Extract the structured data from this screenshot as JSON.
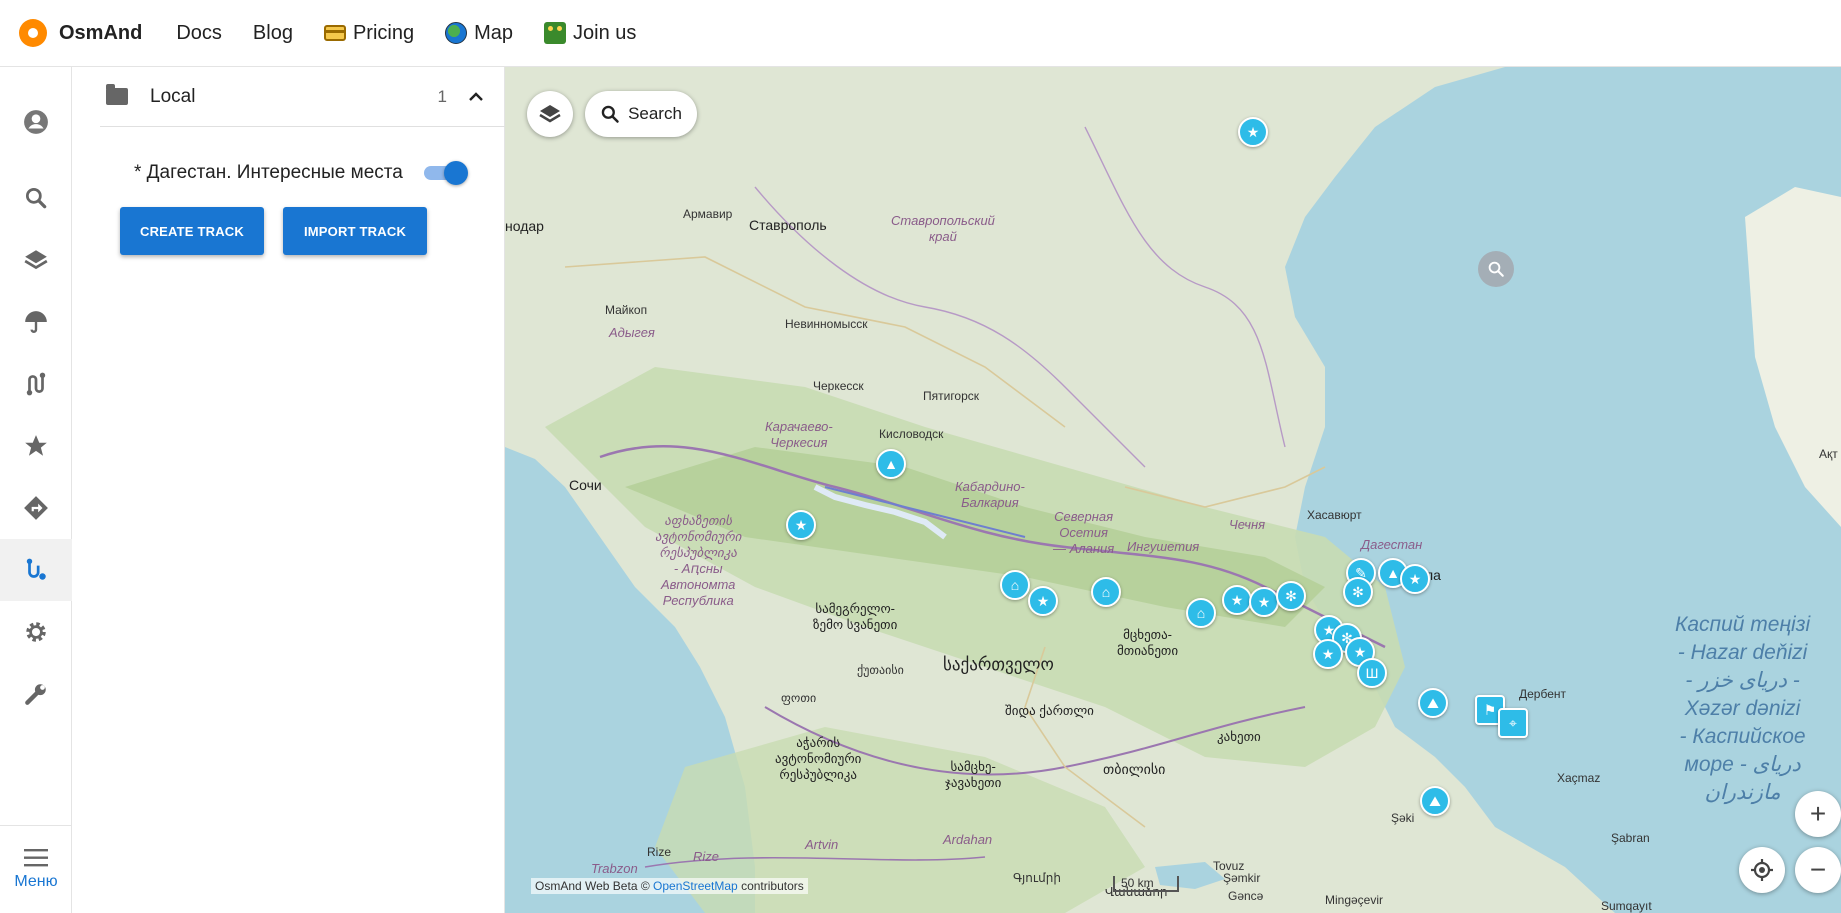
{
  "nav": {
    "brand": "OsmAnd",
    "items": [
      {
        "label": "Docs",
        "icon": ""
      },
      {
        "label": "Blog",
        "icon": ""
      },
      {
        "label": "Pricing",
        "icon": "card-icon"
      },
      {
        "label": "Map",
        "icon": "globe-icon"
      },
      {
        "label": "Join us",
        "icon": "join-icon"
      }
    ]
  },
  "rail": {
    "items": [
      "account-icon",
      "search-icon",
      "layers-icon",
      "weather-icon",
      "route-icon",
      "favorites-icon",
      "navigation-icon",
      "tracks-icon",
      "settings-icon",
      "tools-icon"
    ],
    "active": "tracks-icon",
    "menu_label": "Меню"
  },
  "panel": {
    "group_label": "Local",
    "group_count": "1",
    "track_name": "* Дагестан. Интересные места",
    "track_visible": true,
    "create_label": "CREATE TRACK",
    "import_label": "IMPORT TRACK"
  },
  "map": {
    "search_label": "Search",
    "attribution_prefix": "OsmAnd Web Beta ©",
    "attribution_link": "OpenStreetMap",
    "attribution_suffix": "contributors",
    "scale_label": "50 km",
    "places": {
      "armavir": "Армавир",
      "stavropol": "Ставрополь",
      "krasnodar_fragment": "нодар",
      "stav_krai": "Ставропольский\nкрай",
      "maykop": "Майкоп",
      "adygea": "Адыгея",
      "nevinnomyssk": "Невинномысск",
      "cherkessk": "Черкесск",
      "pyatigorsk": "Пятигорск",
      "kchr": "Карачаево-\nЧеркесия",
      "kislovodsk": "Кисловодск",
      "sochi": "Сочи",
      "kbr": "Кабардино-\nБалкария",
      "north_ossetia": "Северная\nОсетия\n— Алания",
      "ingushetia": "Ингушетия",
      "chechnya": "Чечня",
      "khasavyurt": "Хасавюрт",
      "dagestan": "Дагестан",
      "makhachkala_fragment": "ла",
      "abkhazia": "აფხაზეთის\nავტონომიური\nრესპუბლიკა\n- Аԥсны\nАвтономта\nРеспублика",
      "samegrelo": "სამეგრელო-\nზემო სვანეთი",
      "kutaisi": "ქუთაისი",
      "sakartvelo": "საქართველო",
      "mtskheta": "მცხეთა-\nმთიანეთი",
      "shida_kartli": "შიდა ქართლი",
      "kakheti": "კახეთი",
      "poti": "ფოთი",
      "adjara": "აჭარის\nავტონომიური\nრესპუბლიკა",
      "samtskhe": "სამცხე-\nჯავახეთი",
      "tbilisi": "თბილისი",
      "derbent": "Дербент",
      "khachmaz": "Xaçmaz",
      "shaki": "Şəki",
      "shabran": "Şabran",
      "rize_1": "Rize",
      "rize_2": "Rize",
      "artvin": "Artvin",
      "trabzon": "Trabzon",
      "ardahan": "Ardahan",
      "gyumri": "Գյումրի",
      "vanadzor": "Վանաձոր",
      "tovuz": "Tovuz",
      "shamkir": "Şəmkir",
      "ganja": "Gəncə",
      "mingachevir": "Mingəçevir",
      "sumgait": "Sumqayıt",
      "aktau_fragment": "Ақт",
      "caspian": "Каспий теңізі\n- Hazar deňizi\n- دریای خزر -\nXəzər dənizi\n- Каспийское\nморе - دریای\nمازندران"
    },
    "markers": [
      {
        "icon": "★",
        "kind": "favorite-star"
      },
      {
        "icon": "▲",
        "kind": "peak"
      },
      {
        "icon": "★",
        "kind": "favorite-star"
      },
      {
        "icon": "⌂",
        "kind": "shelter"
      },
      {
        "icon": "★",
        "kind": "favorite-star"
      },
      {
        "icon": "⌂",
        "kind": "shelter"
      },
      {
        "icon": "⌂",
        "kind": "shelter"
      },
      {
        "icon": "★",
        "kind": "favorite-star"
      },
      {
        "icon": "★",
        "kind": "favorite-star"
      },
      {
        "icon": "✻",
        "kind": "waterfall"
      },
      {
        "icon": "✎",
        "kind": "point"
      },
      {
        "icon": "✻",
        "kind": "waterfall"
      },
      {
        "icon": "▲",
        "kind": "peak"
      },
      {
        "icon": "★",
        "kind": "favorite-star"
      },
      {
        "icon": "★",
        "kind": "favorite-star"
      },
      {
        "icon": "✻",
        "kind": "waterfall"
      },
      {
        "icon": "★",
        "kind": "favorite-star"
      },
      {
        "icon": "★",
        "kind": "favorite-star"
      },
      {
        "icon": "Ш",
        "kind": "fortress"
      },
      {
        "icon": "⛰",
        "kind": "viewpoint"
      },
      {
        "icon": "⚑",
        "kind": "flag"
      },
      {
        "icon": "⌖",
        "kind": "pin"
      },
      {
        "icon": "⛰",
        "kind": "viewpoint"
      }
    ]
  },
  "colors": {
    "accent": "#1976d2",
    "marker": "#2ebce8",
    "sea": "#aad3df",
    "land": "#dfe6d4",
    "forest": "#c4dcae",
    "brand": "#ff8a00"
  }
}
